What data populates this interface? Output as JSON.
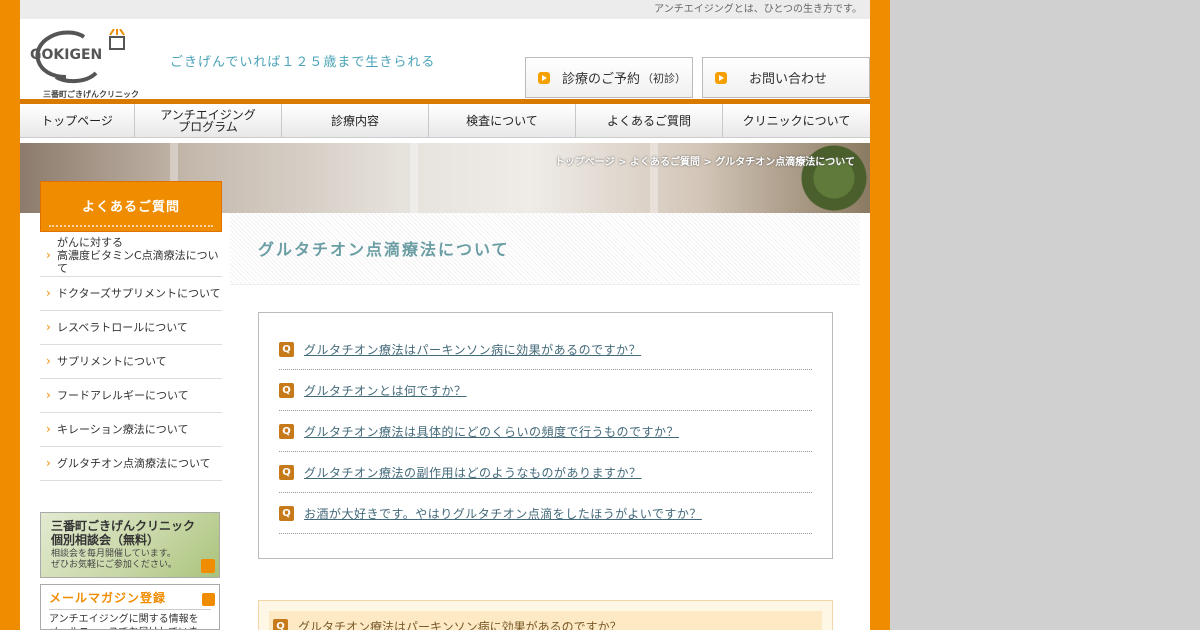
{
  "topbar": {
    "text": "アンチエイジングとは、ひとつの生き方です。"
  },
  "header": {
    "logo_text": "GOKIGEN",
    "logo_sub": "三番町ごきげんクリニック",
    "tagline": "ごきげんでいれば１２５歳まで生きられる",
    "btn_reserve": "診療のご予約",
    "btn_reserve_sub": "（初診）",
    "btn_contact": "お問い合わせ"
  },
  "nav": {
    "items": [
      {
        "label": "トップページ"
      },
      {
        "label": "アンチエイジング\nプログラム"
      },
      {
        "label": "診療内容"
      },
      {
        "label": "検査について"
      },
      {
        "label": "よくあるご質問"
      },
      {
        "label": "クリニックについて"
      }
    ]
  },
  "breadcrumb": "トップページ > よくあるご質問 > グルタチオン点滴療法について",
  "sidebar": {
    "title": "よくあるご質問",
    "items": [
      {
        "label": "がんに対する\n高濃度ビタミンC点滴療法について"
      },
      {
        "label": "ドクターズサプリメントについて"
      },
      {
        "label": "レスベラトロールについて"
      },
      {
        "label": "サプリメントについて"
      },
      {
        "label": "フードアレルギーについて"
      },
      {
        "label": "キレーション療法について"
      },
      {
        "label": "グルタチオン点滴療法について"
      }
    ],
    "banner1": {
      "title": "三番町ごきげんクリニック\n個別相談会（無料）",
      "sub": "相談会を毎月開催しています。\nぜひお気軽にご参加ください。"
    },
    "banner2": {
      "title": "メールマガジン登録",
      "sub": "アンチエイジングに関する情報を\nメールニュースでお届けしています。"
    }
  },
  "main": {
    "title": "グルタチオン点滴療法について",
    "q_icon": "Q",
    "questions": [
      {
        "text": "グルタチオン療法はパーキンソン病に効果があるのですか？"
      },
      {
        "text": "グルタチオンとは何ですか？"
      },
      {
        "text": "グルタチオン療法は具体的にどのくらいの頻度で行うものですか？"
      },
      {
        "text": "グルタチオン療法の副作用はどのようなものがありますか？"
      },
      {
        "text": "お酒が大好きです。やはりグルタチオン点滴をしたほうがよいですか？"
      }
    ],
    "answer_head": "グルタチオン療法はパーキンソン病に効果があるのですか？"
  }
}
